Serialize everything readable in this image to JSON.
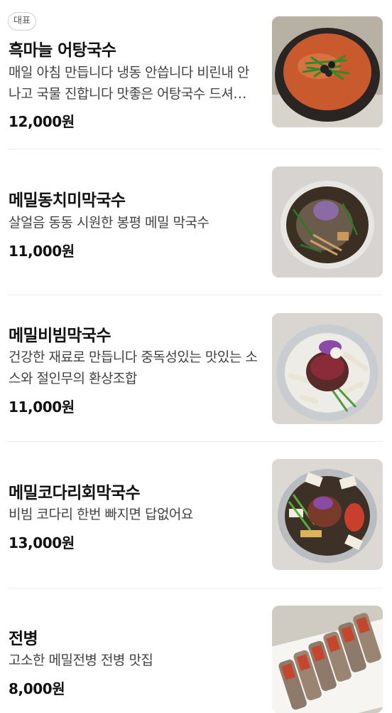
{
  "menu": {
    "items": [
      {
        "badge": "대표",
        "name": "흑마늘 어탕국수",
        "description": "매일 아침 만듭니다 냉동 안씁니다 비린내 안나고 국물 진합니다 맛좋은 어탕국수 드셔보세요",
        "price": "12,000원",
        "image_icon": "fish-noodle-soup-photo"
      },
      {
        "name": "메밀동치미막국수",
        "description": "살얼음 동동 시원한 봉평 메밀 막국수",
        "price": "11,000원",
        "image_icon": "cold-buckwheat-noodles-photo"
      },
      {
        "name": "메밀비빔막국수",
        "description": "건강한 재료로 만듭니다 중독성있는 맛있는 소스와 절인무의 환상조합",
        "price": "11,000원",
        "image_icon": "spicy-buckwheat-noodles-photo"
      },
      {
        "name": "메밀코다리회막국수",
        "description": "비빔 코다리 한번 빠지면 답없어요",
        "price": "13,000원",
        "image_icon": "pollack-buckwheat-noodles-photo"
      },
      {
        "name": "전병",
        "description": "고소한 메밀전병 전병 맛집",
        "price": "8,000원",
        "image_icon": "buckwheat-crepe-photo"
      }
    ]
  }
}
